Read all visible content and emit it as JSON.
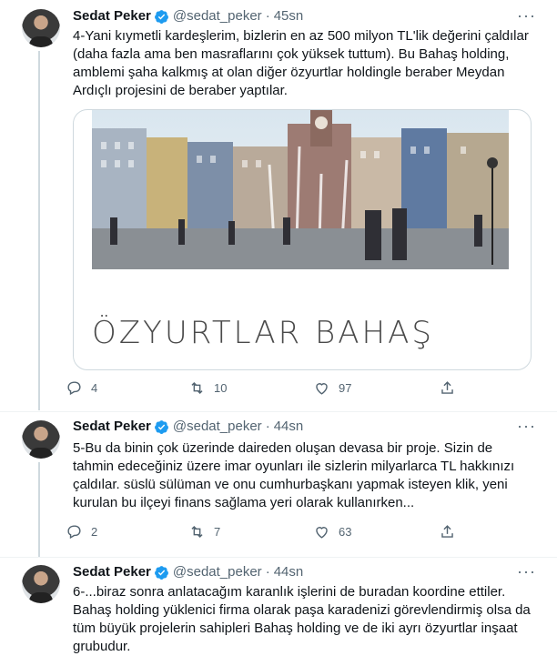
{
  "tweets": [
    {
      "author_name": "Sedat Peker",
      "handle": "@sedat_peker",
      "time": "45sn",
      "text": "4-Yani kıymetli kardeşlerim, bizlerin en az 500 milyon TL'lik değerini çaldılar (daha fazla ama ben masraflarını çok yüksek tuttum). Bu Bahaş holding, amblemi şaha kalkmış at olan diğer özyurtlar holdingle beraber Meydan Ardıçlı projesini de beraber yaptılar.",
      "card_caption": "ÖZYURTLAR BAHAŞ",
      "replies": "4",
      "retweets": "10",
      "likes": "97"
    },
    {
      "author_name": "Sedat Peker",
      "handle": "@sedat_peker",
      "time": "44sn",
      "text": "5-Bu da binin çok üzerinde daireden oluşan devasa bir proje. Sizin de tahmin edeceğiniz üzere imar oyunları ile sizlerin milyarlarca TL hakkınızı çaldılar. süslü sülüman ve onu cumhurbaşkanı yapmak isteyen klik, yeni kurulan bu ilçeyi finans sağlama yeri olarak kullanırken...",
      "replies": "2",
      "retweets": "7",
      "likes": "63"
    },
    {
      "author_name": "Sedat Peker",
      "handle": "@sedat_peker",
      "time": "44sn",
      "text": "6-...biraz sonra anlatacağım karanlık işlerini de buradan koordine ettiler. Bahaş holding yüklenici firma olarak paşa karadenizi görevlendirmiş olsa da tüm büyük projelerin sahipleri Bahaş holding ve de iki ayrı özyurtlar inşaat grubudur."
    }
  ],
  "separator": "·",
  "colors": {
    "verified": "#1d9bf0",
    "muted": "#536471",
    "border": "#cfd9de"
  }
}
